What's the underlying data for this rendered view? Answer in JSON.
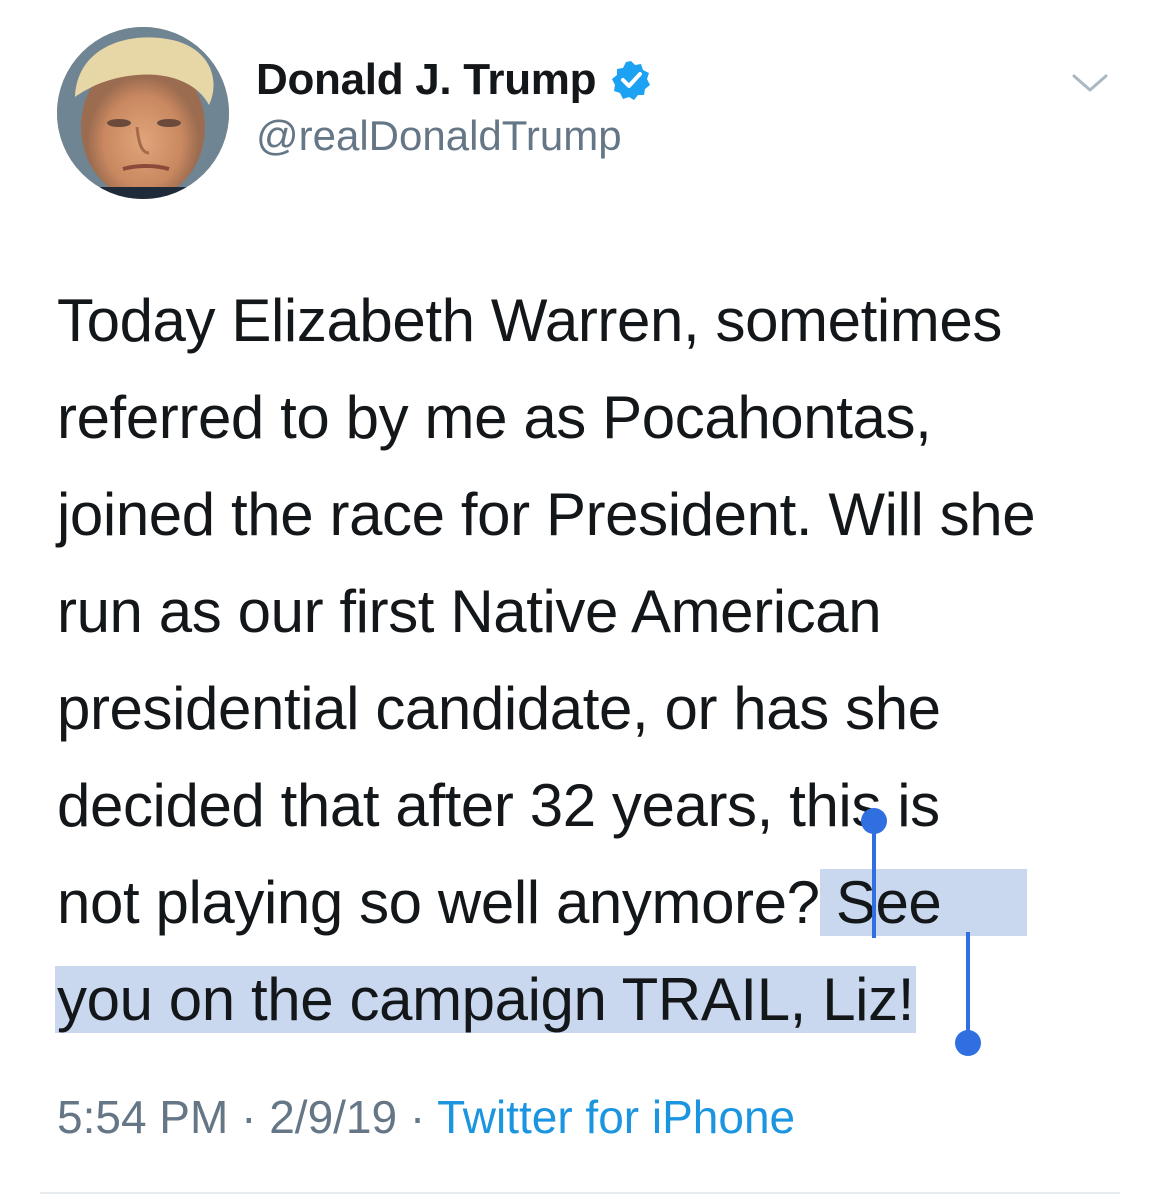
{
  "tweet": {
    "author": {
      "display_name": "Donald J. Trump",
      "handle": "@realDonaldTrump",
      "verified": true
    },
    "text_lines": [
      "Today Elizabeth Warren, sometimes",
      "referred to by me as Pocahontas,",
      "joined the race for President. Will she",
      "run as our first Native American",
      "presidential candidate, or has she",
      "decided that after 32 years, this is"
    ],
    "line7_before_selection": "not playing so well anymore?",
    "line7_selected": " See",
    "line8_selected": "you on the campaign TRAIL, Liz!",
    "time": "5:54 PM",
    "date": "2/9/19",
    "separator": "·",
    "source": "Twitter for iPhone"
  },
  "colors": {
    "text": "#14171a",
    "secondary": "#657786",
    "link": "#1b95e0",
    "selection": "#c9d8ee",
    "selection_handle": "#2f6fe0",
    "verified": "#1da1f2"
  },
  "icons": {
    "verified": "verified-badge-icon",
    "menu": "chevron-down-icon",
    "avatar": "profile-photo"
  }
}
